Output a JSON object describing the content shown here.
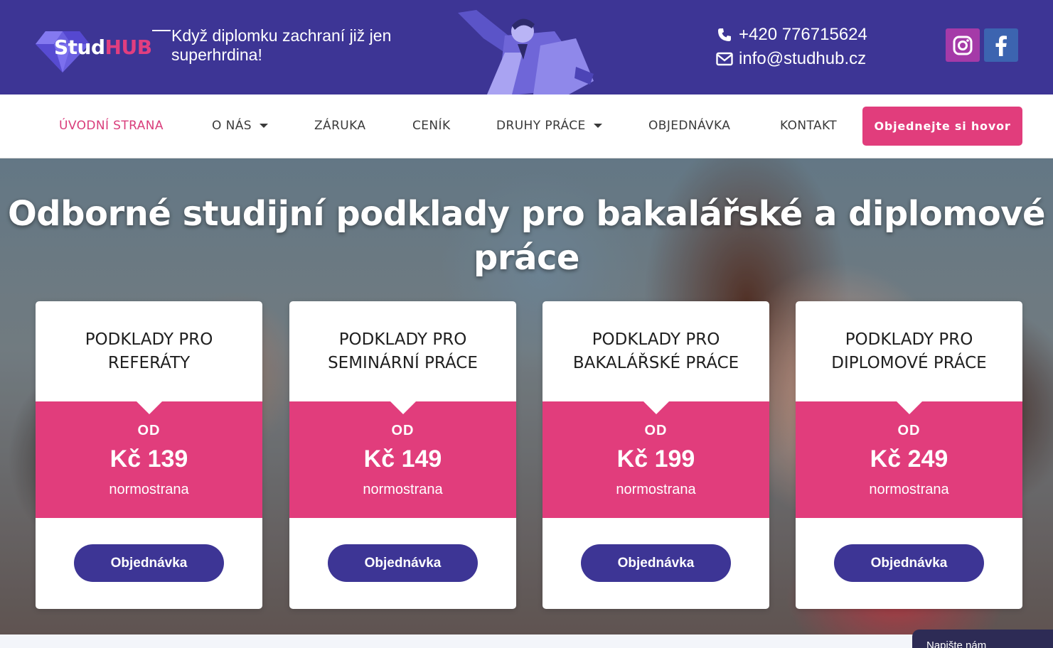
{
  "header": {
    "logo": {
      "stud": "Stud",
      "hub": "HUB"
    },
    "tagline": "Když diplomku zachraní již jen superhrdina!",
    "phone": "+420 776715624",
    "email": "info@studhub.cz",
    "colors": {
      "header_bg": "#3d3595",
      "accent": "#e13d7c"
    },
    "social": [
      {
        "name": "instagram-icon"
      },
      {
        "name": "facebook-icon"
      }
    ]
  },
  "nav": {
    "items": [
      {
        "label": "ÚVODNÍ STRANA",
        "active": true
      },
      {
        "label": "O NÁS",
        "dropdown": true
      },
      {
        "label": "ZÁRUKA"
      },
      {
        "label": "CENÍK"
      },
      {
        "label": "DRUHY PRÁCE",
        "dropdown": true
      },
      {
        "label": "OBJEDNÁVKA"
      },
      {
        "label": "KONTAKT"
      }
    ],
    "cta": "Objednejte si hovor"
  },
  "hero": {
    "title_line1": "Odborné studijní podklady pro bakalářské a diplomové",
    "title_line2": "práce"
  },
  "cards": [
    {
      "title_line1": "PODKLADY PRO",
      "title_line2": "REFERÁTY",
      "od": "OD",
      "price": "Kč 139",
      "unit": "normostrana",
      "button": "Objednávka"
    },
    {
      "title_line1": "PODKLADY PRO",
      "title_line2": "SEMINÁRNÍ PRÁCE",
      "od": "OD",
      "price": "Kč 149",
      "unit": "normostrana",
      "button": "Objednávka"
    },
    {
      "title_line1": "PODKLADY PRO",
      "title_line2": "BAKALÁŘSKÉ PRÁCE",
      "od": "OD",
      "price": "Kč 199",
      "unit": "normostrana",
      "button": "Objednávka"
    },
    {
      "title_line1": "PODKLADY PRO",
      "title_line2": "DIPLOMOVÉ PRÁCE",
      "od": "OD",
      "price": "Kč 249",
      "unit": "normostrana",
      "button": "Objednávka"
    }
  ],
  "chat": {
    "label": "Napište nám"
  }
}
